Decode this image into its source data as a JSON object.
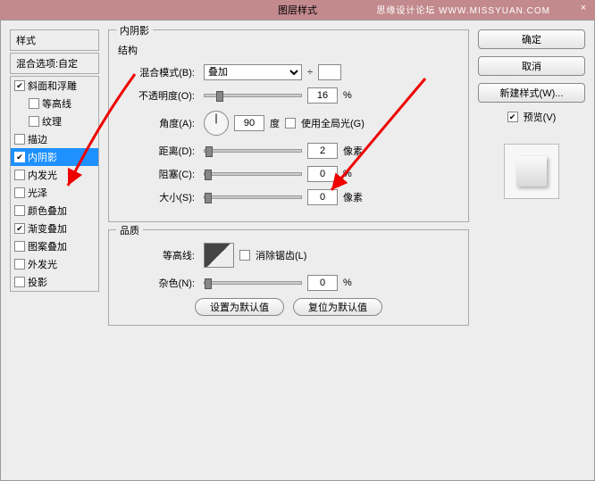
{
  "titlebar": {
    "title": "图层样式",
    "watermark": "思缘设计论坛  WWW.MISSYUAN.COM"
  },
  "left": {
    "header1": "样式",
    "header2": "混合选项:自定",
    "items": [
      {
        "label": "斜面和浮雕",
        "checked": true,
        "selected": false,
        "indent": 0
      },
      {
        "label": "等高线",
        "checked": false,
        "selected": false,
        "indent": 1
      },
      {
        "label": "纹理",
        "checked": false,
        "selected": false,
        "indent": 1
      },
      {
        "label": "描边",
        "checked": false,
        "selected": false,
        "indent": 0
      },
      {
        "label": "内阴影",
        "checked": true,
        "selected": true,
        "indent": 0
      },
      {
        "label": "内发光",
        "checked": false,
        "selected": false,
        "indent": 0
      },
      {
        "label": "光泽",
        "checked": false,
        "selected": false,
        "indent": 0
      },
      {
        "label": "颜色叠加",
        "checked": false,
        "selected": false,
        "indent": 0
      },
      {
        "label": "渐变叠加",
        "checked": true,
        "selected": false,
        "indent": 0
      },
      {
        "label": "图案叠加",
        "checked": false,
        "selected": false,
        "indent": 0
      },
      {
        "label": "外发光",
        "checked": false,
        "selected": false,
        "indent": 0
      },
      {
        "label": "投影",
        "checked": false,
        "selected": false,
        "indent": 0
      }
    ]
  },
  "center": {
    "title": "内阴影",
    "structure_title": "结构",
    "blend_label": "混合模式(B):",
    "blend_value": "叠加",
    "opacity_label": "不透明度(O):",
    "opacity_value": "16",
    "opacity_unit": "%",
    "angle_label": "角度(A):",
    "angle_value": "90",
    "angle_unit": "度",
    "global_light": "使用全局光(G)",
    "distance_label": "距离(D):",
    "distance_value": "2",
    "distance_unit": "像素",
    "choke_label": "阻塞(C):",
    "choke_value": "0",
    "choke_unit": "%",
    "size_label": "大小(S):",
    "size_value": "0",
    "size_unit": "像素",
    "quality_title": "品质",
    "contour_label": "等高线:",
    "antialias": "消除锯齿(L)",
    "noise_label": "杂色(N):",
    "noise_value": "0",
    "noise_unit": "%",
    "btn_default": "设置为默认值",
    "btn_reset": "复位为默认值"
  },
  "right": {
    "ok": "确定",
    "cancel": "取消",
    "new_style": "新建样式(W)...",
    "preview": "预览(V)"
  }
}
